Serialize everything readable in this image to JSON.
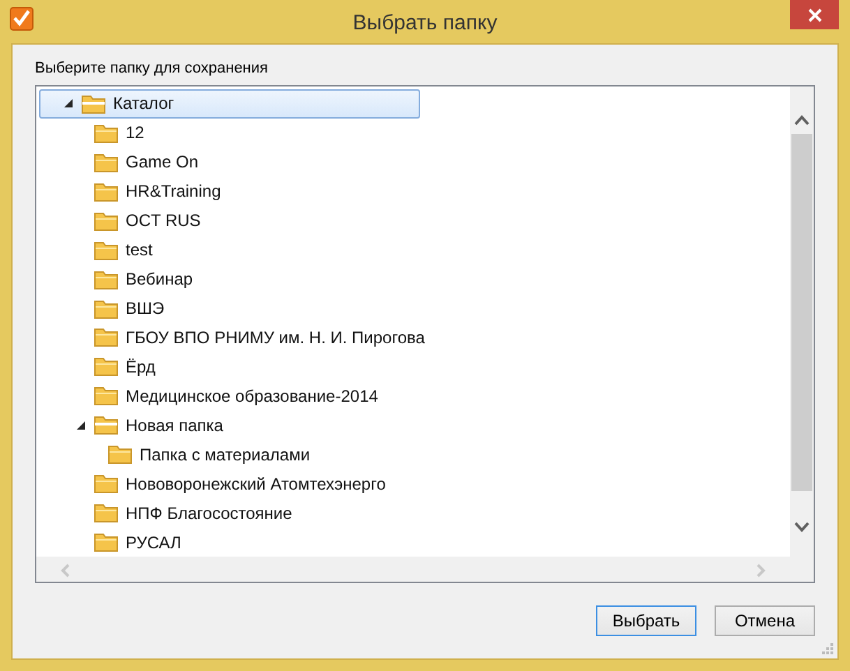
{
  "window": {
    "title": "Выбрать папку"
  },
  "prompt": "Выберите папку для сохранения",
  "tree": [
    {
      "label": "Каталог",
      "expanded": true,
      "selected": true,
      "children": [
        {
          "label": "12",
          "selected": false
        },
        {
          "label": "Game On",
          "selected": false
        },
        {
          "label": "HR&Training",
          "selected": false
        },
        {
          "label": "OCT RUS",
          "selected": false
        },
        {
          "label": "test",
          "selected": false
        },
        {
          "label": "Вебинар",
          "selected": false
        },
        {
          "label": "ВШЭ",
          "selected": false
        },
        {
          "label": "ГБОУ ВПО РНИМУ им. Н. И. Пирогова",
          "selected": false
        },
        {
          "label": "Ёрд",
          "selected": false
        },
        {
          "label": "Медицинское образование-2014",
          "selected": false
        },
        {
          "label": "Новая папка",
          "expanded": true,
          "selected": false,
          "children": [
            {
              "label": "Папка с материалами",
              "selected": false
            }
          ]
        },
        {
          "label": "Нововоронежский Атомтехэнерго",
          "selected": false
        },
        {
          "label": "НПФ Благосостояние",
          "selected": false
        },
        {
          "label": "РУСАЛ",
          "selected": false
        }
      ]
    }
  ],
  "buttons": [
    {
      "label": "Выбрать",
      "kind": "primary"
    },
    {
      "label": "Отмена",
      "kind": "secondary"
    }
  ]
}
